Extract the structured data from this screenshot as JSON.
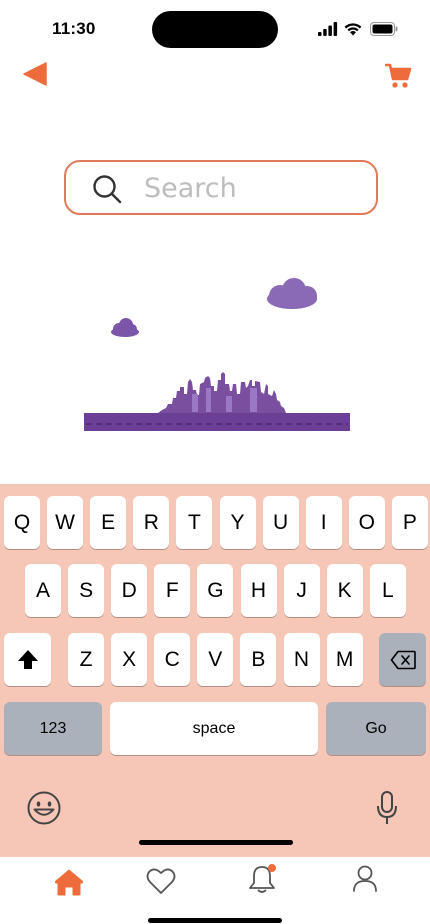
{
  "status_bar": {
    "time": "11:30"
  },
  "search": {
    "placeholder": "Search",
    "value": ""
  },
  "colors": {
    "accent": "#ee6b3b",
    "illustration": "#7a4fa0",
    "keyboard_bg": "#f6c6b7"
  },
  "keyboard": {
    "row1": [
      "Q",
      "W",
      "E",
      "R",
      "T",
      "Y",
      "U",
      "I",
      "O",
      "P"
    ],
    "row2": [
      "A",
      "S",
      "D",
      "F",
      "G",
      "H",
      "J",
      "K",
      "L"
    ],
    "row3": [
      "Z",
      "X",
      "C",
      "V",
      "B",
      "N",
      "M"
    ],
    "numbers_label": "123",
    "space_label": "space",
    "go_label": "Go"
  },
  "icons": {
    "back": "back-arrow-icon",
    "cart": "cart-icon",
    "search": "search-icon",
    "shift": "shift-icon",
    "delete": "backspace-icon",
    "emoji": "emoji-icon",
    "mic": "microphone-icon"
  },
  "tabs": [
    {
      "id": "home",
      "icon": "home-icon",
      "active": true
    },
    {
      "id": "favorites",
      "icon": "heart-icon",
      "active": false
    },
    {
      "id": "notifications",
      "icon": "bell-icon",
      "active": false,
      "badge": true
    },
    {
      "id": "profile",
      "icon": "user-icon",
      "active": false
    }
  ]
}
